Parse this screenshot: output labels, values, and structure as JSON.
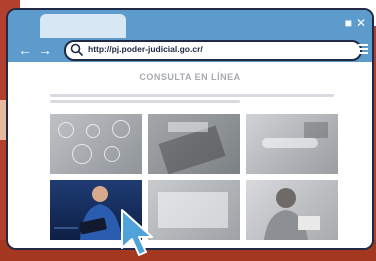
{
  "browser": {
    "tab_new_icon": "plus-icon",
    "window_controls": [
      "restore-icon",
      "close-icon"
    ],
    "nav": {
      "back_icon": "arrow-left-icon",
      "forward_icon": "arrow-right-icon"
    },
    "address_bar": {
      "search_icon": "search-icon",
      "url": "http://pj.poder-judicial.go.cr/"
    },
    "menu_icon": "hamburger-menu-icon"
  },
  "page": {
    "title": "CONSULTA EN LÍNEA"
  },
  "tiles": [
    {
      "name": "tile-tech-icons"
    },
    {
      "name": "tile-calculator"
    },
    {
      "name": "tile-handshake"
    },
    {
      "name": "tile-tablet-user"
    },
    {
      "name": "tile-documents"
    },
    {
      "name": "tile-woman-reading"
    }
  ],
  "colors": {
    "browser_blue": "#5e9bcd",
    "frame_dark": "#202a44",
    "backdrop_red": "#b3402c",
    "cursor_blue": "#4fa3d9"
  }
}
